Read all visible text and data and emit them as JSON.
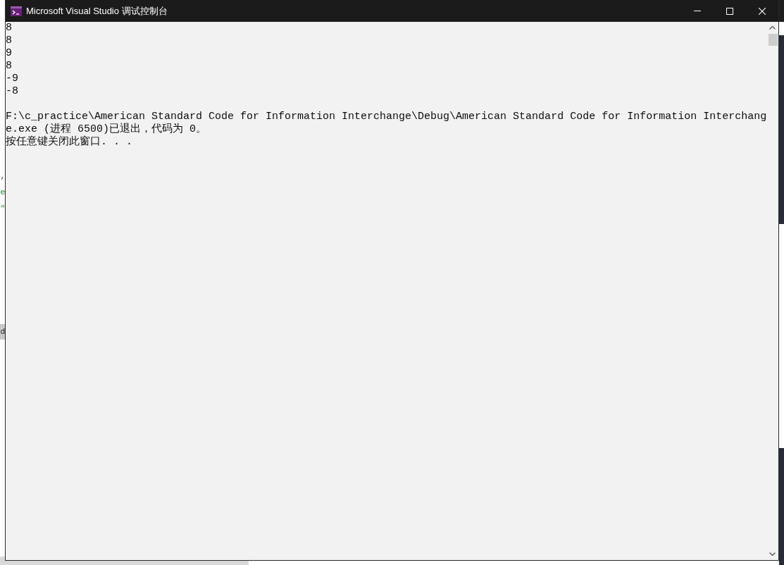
{
  "article_page_edge": {
    "lines": [
      {
        "kind": "code",
        "text": ","
      },
      {
        "kind": "string",
        "text": "e"
      },
      {
        "kind": "string",
        "text": "\""
      },
      {
        "kind": "highlighted_code",
        "text": "d"
      }
    ]
  },
  "console": {
    "title": "Microsoft Visual Studio 调试控制台",
    "output": [
      "8",
      "8",
      "9",
      "8",
      "-9",
      "-8"
    ],
    "exit_message": "F:\\c_practice\\American Standard Code for Information Interchange\\Debug\\American Standard Code for Information Interchange.exe (进程 6500)已退出，代码为 0。",
    "prompt": "按任意键关闭此窗口. . ."
  }
}
